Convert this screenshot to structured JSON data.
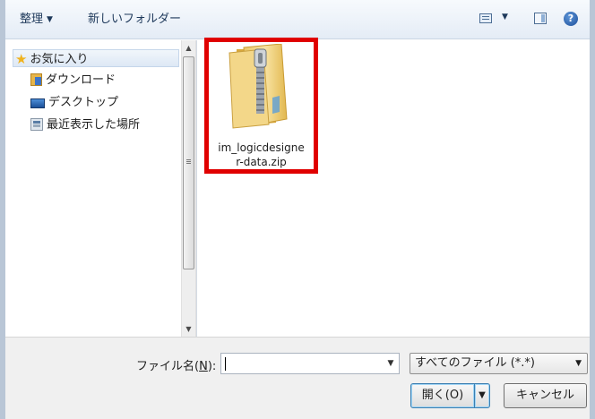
{
  "toolbar": {
    "organize_label": "整理",
    "new_folder_label": "新しいフォルダー",
    "view_icon": "view-options-icon",
    "preview_pane_icon": "preview-pane-icon",
    "help_icon": "help-icon",
    "help_glyph": "?"
  },
  "nav": {
    "items": [
      {
        "label": "お気に入り",
        "icon": "star-icon"
      },
      {
        "label": "ダウンロード",
        "icon": "downloads-folder-icon"
      },
      {
        "label": "デスクトップ",
        "icon": "desktop-icon"
      },
      {
        "label": "最近表示した場所",
        "icon": "recent-places-icon"
      }
    ]
  },
  "files": {
    "items": [
      {
        "name_line1": "im_logicdesigne",
        "name_line2": "r-data.zip",
        "icon": "zip-folder-icon",
        "highlighted": true
      }
    ],
    "highlight_color": "#e00000"
  },
  "footer": {
    "filename_label": "ファイル名(",
    "filename_access": "N",
    "filename_label_end": "):",
    "filename_value": "",
    "filetype_selected": "すべてのファイル (*.*)",
    "open_label": "開く(O)",
    "cancel_label": "キャンセル"
  }
}
